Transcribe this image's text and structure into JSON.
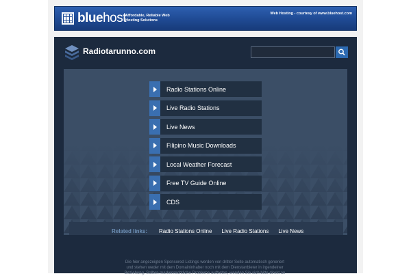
{
  "banner": {
    "brand_prefix": "blue",
    "brand_suffix": "host",
    "tagline": "Affordable, Reliable Web Hosting Solutions",
    "courtesy": "Web Hosting - courtesy of www.bluehost.com"
  },
  "site": {
    "title": "Radiotarunno.com"
  },
  "search": {
    "value": "",
    "placeholder": ""
  },
  "menu": [
    "Radio Stations Online",
    "Live Radio Stations",
    "Live News",
    "Filipino Music Downloads",
    "Local Weather Forecast",
    "Free TV Guide Online",
    "CDS"
  ],
  "related": {
    "label": "Related links:",
    "links": [
      "Radio Stations Online",
      "Live Radio Stations",
      "Live News"
    ]
  },
  "disclaimer": "Die hier angezeigten Sponsored Listings werden von dritter Seite automatisch generiert und stehen weder mit dem Domaininhaber noch mit dem Dienstanbieter in irgendeiner Beziehung. Sollten markenrechtliche Probleme auftreten, wenden Sie sich bitte direkt an",
  "colors": {
    "banner_blue": "#1f4a93",
    "site_bg": "#1c2a3e",
    "panel_bg": "#3b4e66",
    "menu_bg": "#213042",
    "accent": "#3a6fb0",
    "related_label": "#6d8fb5"
  },
  "icons": {
    "banner_logo": "bluehost-grid-logo",
    "site_logo": "stacked-layers-icon",
    "search": "search-icon",
    "menu_bullet": "play-arrow-icon"
  }
}
